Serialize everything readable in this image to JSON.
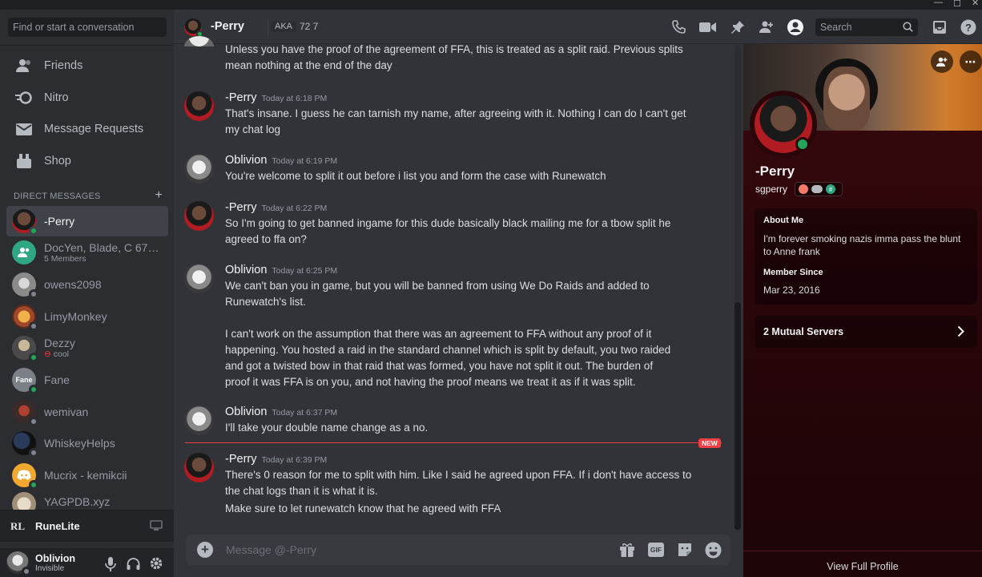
{
  "sidebar": {
    "search_placeholder": "Find or start a conversation",
    "nav": [
      "Friends",
      "Nitro",
      "Message Requests",
      "Shop"
    ],
    "dm_header": "DIRECT MESSAGES",
    "dm_add": "+",
    "dms": [
      {
        "name": "-Perry",
        "sub": ""
      },
      {
        "name": "DocYen, Blade, C 678, ...",
        "sub": "5 Members"
      },
      {
        "name": "owens2098",
        "sub": ""
      },
      {
        "name": "LimyMonkey",
        "sub": ""
      },
      {
        "name": "Dezzy",
        "sub": "cool"
      },
      {
        "name": "Fane",
        "sub": ""
      },
      {
        "name": "wemivan",
        "sub": ""
      },
      {
        "name": "WhiskeyHelps",
        "sub": ""
      },
      {
        "name": "Mucrix - kemikcii",
        "sub": ""
      },
      {
        "name": "YAGPDB.xyz",
        "sub": ""
      }
    ],
    "fane_avatar_text": "Fane",
    "app_name": "RuneLite",
    "app_logo": "RL",
    "user": {
      "name": "Oblivion",
      "status": "Invisible"
    }
  },
  "header": {
    "title": "-Perry",
    "aka_label": "AKA",
    "aka_value": "72 7",
    "search_placeholder": "Search"
  },
  "messages": [
    {
      "author": "",
      "time": "",
      "text": "Unless you have the proof of the agreement of FFA, this is treated as a split raid. Previous splits\nmean nothing at the end of the day"
    },
    {
      "author": "-Perry",
      "time": "Today at 6:18 PM",
      "text": "That's insane. I guess he can tarnish my name, after agreeing with it. Nothing I can do I can't get\nmy chat log"
    },
    {
      "author": "Oblivion",
      "time": "Today at 6:19 PM",
      "text": "You're welcome to split it out before i list you and form the case with Runewatch"
    },
    {
      "author": "-Perry",
      "time": "Today at 6:22 PM",
      "text": "So I'm going to get banned ingame for this dude basically black mailing me for a tbow split he\nagreed to ffa on?"
    },
    {
      "author": "Oblivion",
      "time": "Today at 6:25 PM",
      "text": "We can't ban you in game, but you will be banned from using We Do Raids and added to\nRunewatch's list.\n\nI can't work on the assumption that there was an agreement to FFA without any proof of it\nhappening. You hosted a raid in the standard channel which is split by default, you two raided\nand got a twisted bow in that raid that was formed, you have not split it out. The burden of\nproof it was FFA is on you, and not having the proof means we treat it as if it was split."
    },
    {
      "author": "Oblivion",
      "time": "Today at 6:37 PM",
      "text": "I'll take your double name change as a no."
    },
    {
      "author": "-Perry",
      "time": "Today at 6:39 PM",
      "text": "There's 0 reason for me to split with him. Like I said he agreed upon FFA. If i don't have access to\nthe chat logs than it is what it is."
    },
    {
      "author": "",
      "time": "",
      "text": "Make sure to let runewatch know that he agreed with FFA"
    }
  ],
  "new_badge": "NEW",
  "composer": {
    "placeholder": "Message @-Perry",
    "gif_label": "GIF"
  },
  "profile": {
    "name": "-Perry",
    "username": "sgperry",
    "about_title": "About Me",
    "about_text": "I'm forever smoking nazis imma pass the blunt\nto Anne frank",
    "member_since_title": "Member Since",
    "member_since": "Mar 23, 2016",
    "mutual_servers": "2 Mutual Servers",
    "view_full": "View Full Profile"
  },
  "colors": {
    "accent": "#5865f2",
    "online": "#23a55a",
    "danger": "#f23f43"
  }
}
